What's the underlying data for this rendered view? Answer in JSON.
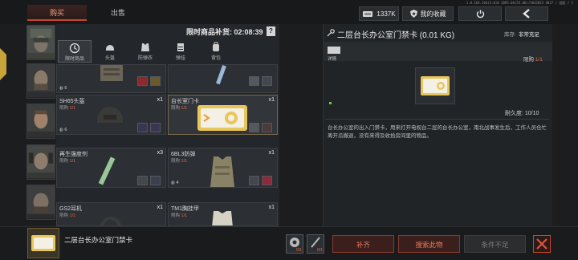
{
  "version": "1.0.164.164(3.0)0 1095.06(55.06)/5642023 4027 / 低配 / C",
  "tabs": {
    "buy": "购买",
    "sell": "出售"
  },
  "topbar": {
    "money": "1337K",
    "favorites": "我的收藏"
  },
  "limit_restock": {
    "label": "限时商品补货: 02:08:39",
    "help": "?"
  },
  "categories": [
    {
      "label": "限时商品",
      "icon": "clock-icon"
    },
    {
      "label": "头盔",
      "icon": "helmet-icon"
    },
    {
      "label": "防弹衣",
      "icon": "vest-icon"
    },
    {
      "label": "弹挂",
      "icon": "rig-icon"
    },
    {
      "label": "背包",
      "icon": "backpack-icon"
    }
  ],
  "items": [
    {
      "name": "",
      "limit_label": "",
      "limit": "",
      "qty": "",
      "stock": "6"
    },
    {
      "name": "",
      "limit_label": "",
      "limit": "",
      "qty": "",
      "stock": ""
    },
    {
      "name": "SH65头盔",
      "limit_label": "限购",
      "limit": "1/1",
      "qty": "x1",
      "stock": "6"
    },
    {
      "name": "台长室门卡",
      "limit_label": "限购",
      "limit": "1/1",
      "qty": "x1",
      "stock": ""
    },
    {
      "name": "再生强度剂",
      "limit_label": "限购",
      "limit": "1/1",
      "qty": "x3",
      "stock": ""
    },
    {
      "name": "6BL3防弹",
      "limit_label": "限购",
      "limit": "1/1",
      "qty": "x1",
      "stock": "4"
    },
    {
      "name": "GS2耳机",
      "limit_label": "限购",
      "limit": "1/1",
      "qty": "x1",
      "stock": ""
    },
    {
      "name": "TM1胸挂甲",
      "limit_label": "限购",
      "limit": "1/1",
      "qty": "x1",
      "stock": ""
    }
  ],
  "detail": {
    "title": "二层台长办公室门禁卡 (0.01 KG)",
    "stock_label": "库存:",
    "stock_value": "非常充足",
    "info_label": "详情",
    "limit_label": "限购",
    "limit_value": "1/1",
    "durability": "耐久度: 10/10",
    "description": "台长办公室的出入门禁卡，用来打开电视台二层的台长办公室，南北战事发生后，工作人员仓忙离开瓜撤退，没有来得及收拾房间里的物品。"
  },
  "selected": {
    "name": "二层台长办公室门禁卡",
    "requirements": [
      {
        "count": "0/1"
      },
      {
        "count": "0/1"
      }
    ]
  },
  "buttons": {
    "fill": "补齐",
    "search": "搜索此物",
    "condition": "条件不足"
  },
  "colors": {
    "accent": "#c8452c",
    "limit_red": "#e26a4c",
    "card_gold": "#e8c65a"
  }
}
